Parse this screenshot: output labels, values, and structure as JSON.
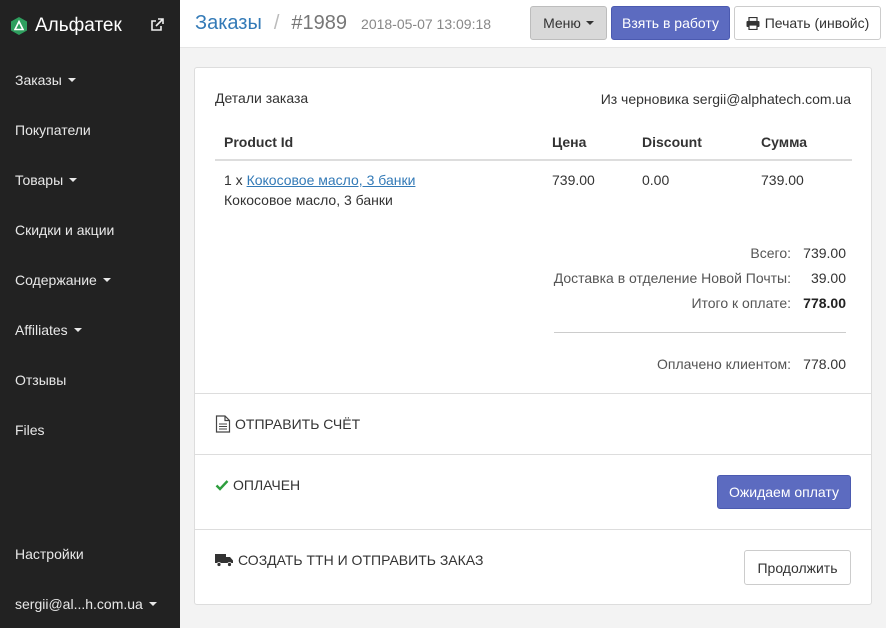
{
  "sidebar": {
    "brand": "Альфатек",
    "items": [
      {
        "label": "Заказы",
        "has_caret": true
      },
      {
        "label": "Покупатели",
        "has_caret": false
      },
      {
        "label": "Товары",
        "has_caret": true
      },
      {
        "label": "Скидки и акции",
        "has_caret": false
      },
      {
        "label": "Содержание",
        "has_caret": true
      },
      {
        "label": "Affiliates",
        "has_caret": true
      },
      {
        "label": "Отзывы",
        "has_caret": false
      },
      {
        "label": "Files",
        "has_caret": false
      }
    ],
    "settings": "Настройки",
    "user": "sergii@al...h.com.ua"
  },
  "header": {
    "crumb_orders": "Заказы",
    "separator": "/",
    "order_number": "#1989",
    "order_date": "2018-05-07 13:09:18",
    "menu_label": "Меню",
    "take_label": "Взять в работу",
    "print_label": "Печать (инвойс)"
  },
  "panel": {
    "title": "Детали заказа",
    "draft_note": "Из черновика sergii@alphatech.com.ua",
    "columns": [
      "Product Id",
      "Цена",
      "Discount",
      "Сумма"
    ],
    "rows": [
      {
        "qty": "1 x",
        "product": "Кокосовое масло, 3 банки",
        "variant": "Кокосовое масло, 3 банки",
        "price": "739.00",
        "discount": "0.00",
        "sum": "739.00"
      }
    ],
    "totals": [
      {
        "label": "Всего:",
        "value": "739.00",
        "bold": false
      },
      {
        "label": "Доставка в отделение Новой Почты:",
        "value": "39.00",
        "bold": false
      },
      {
        "label": "Итого к оплате:",
        "value": "778.00",
        "bold": true
      }
    ],
    "paid": {
      "label": "Оплачено клиентом:",
      "value": "778.00"
    },
    "send_invoice": "ОТПРАВИТЬ СЧЁТ",
    "paid_status": "ОПЛАЧЕН",
    "wait_payment": "Ожидаем оплату",
    "create_ttn": "СОЗДАТЬ ТТН И ОТПРАВИТЬ ЗАКАЗ",
    "continue": "Продолжить"
  },
  "colors": {
    "sidebar_bg": "#222222",
    "primary_button": "#5c6bc0",
    "link": "#337ab7",
    "check_green": "#2e9e3e"
  },
  "icons": [
    "brand-logo-icon",
    "external-link-icon",
    "print-icon",
    "document-icon",
    "check-icon",
    "truck-icon",
    "caret-down-icon"
  ]
}
